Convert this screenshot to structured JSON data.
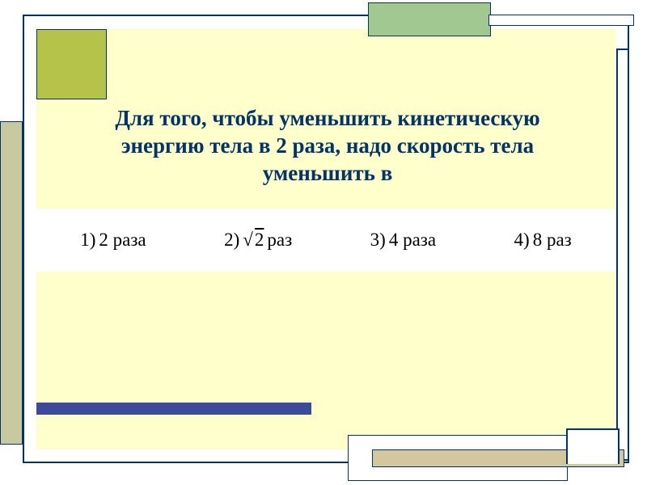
{
  "question": {
    "line1": "Для того, чтобы уменьшить кинетическую",
    "line2": "энергию тела в 2 раза, надо скорость тела",
    "line3": "уменьшить в"
  },
  "answers": {
    "a1_num": "1)",
    "a1_text": "2 раза",
    "a2_num": "2)",
    "a2_radicand": "2",
    "a2_unit": "раз",
    "a3_num": "3)",
    "a3_text": "4 раза",
    "a4_num": "4)",
    "a4_text": "8 раз"
  }
}
